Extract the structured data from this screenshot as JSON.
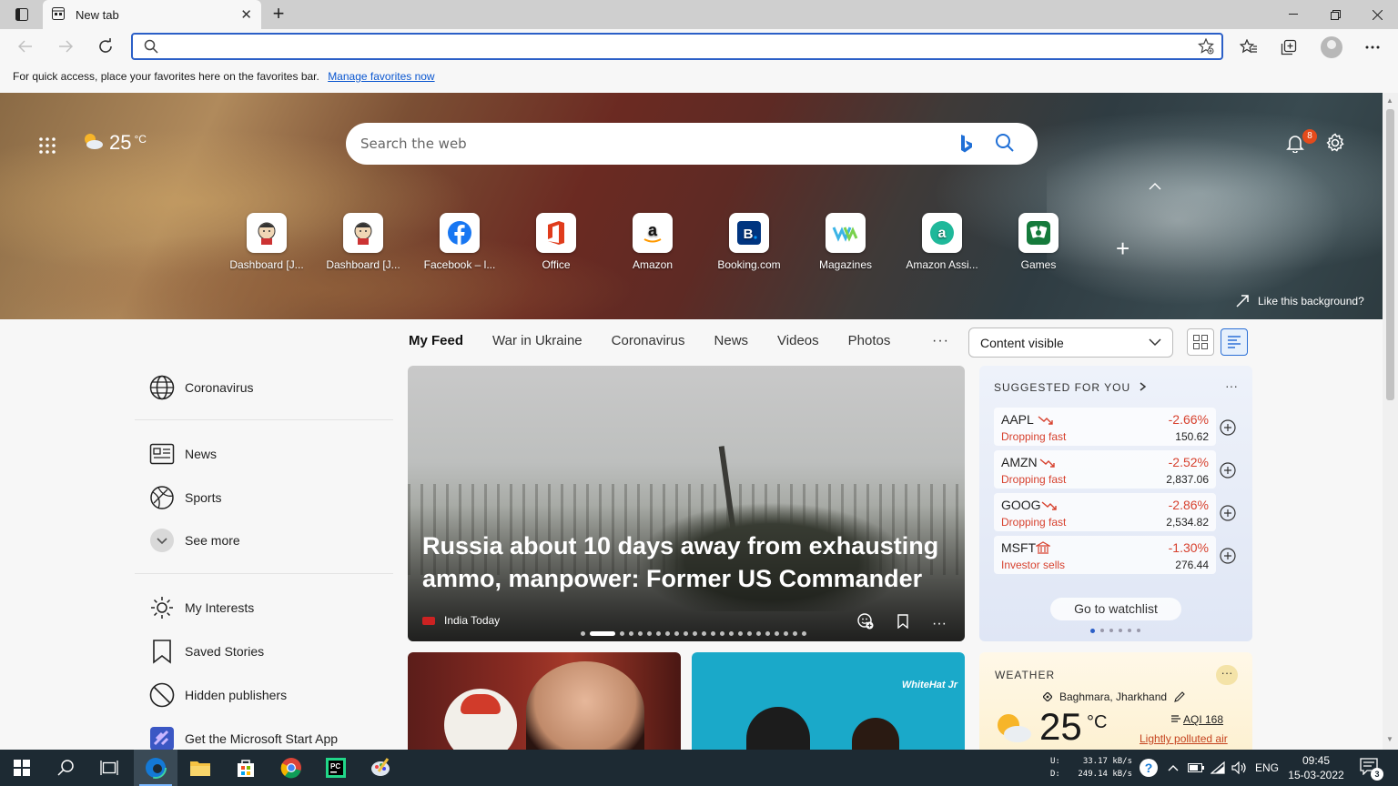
{
  "browser": {
    "tab_title": "New tab",
    "address_placeholder": "",
    "favorites_prompt": "For quick access, place your favorites here on the favorites bar.",
    "favorites_link": "Manage favorites now"
  },
  "hero": {
    "weather_temp": "25",
    "weather_unit": "°C",
    "search_placeholder": "Search the web",
    "notification_count": "8",
    "like_background": "Like this background?",
    "quick_links": [
      {
        "label": "Dashboard [J...",
        "icon": "jenkins-icon"
      },
      {
        "label": "Dashboard [J...",
        "icon": "jenkins-icon"
      },
      {
        "label": "Facebook – l...",
        "icon": "facebook-icon"
      },
      {
        "label": "Office",
        "icon": "office-icon"
      },
      {
        "label": "Amazon",
        "icon": "amazon-icon"
      },
      {
        "label": "Booking.com",
        "icon": "booking-icon"
      },
      {
        "label": "Magazines",
        "icon": "magazines-icon"
      },
      {
        "label": "Amazon Assi...",
        "icon": "amazon-assistant-icon"
      },
      {
        "label": "Games",
        "icon": "games-icon"
      }
    ]
  },
  "feed_nav": {
    "tabs": [
      "My Feed",
      "War in Ukraine",
      "Coronavirus",
      "News",
      "Videos",
      "Photos"
    ],
    "more": "···",
    "content_select": "Content visible"
  },
  "left_nav": {
    "coronavirus": "Coronavirus",
    "news": "News",
    "sports": "Sports",
    "see_more": "See more",
    "my_interests": "My Interests",
    "saved_stories": "Saved Stories",
    "hidden_publishers": "Hidden publishers",
    "ms_start": "Get the Microsoft Start App"
  },
  "main_article": {
    "headline": "Russia about 10 days away from exhausting ammo, manpower: Former US Commander",
    "source": "India Today",
    "more": "···"
  },
  "stocks": {
    "header": "SUGGESTED FOR YOU",
    "more": "···",
    "items": [
      {
        "symbol": "AAPL",
        "status": "Dropping fast",
        "change": "-2.66%",
        "price": "150.62"
      },
      {
        "symbol": "AMZN",
        "status": "Dropping fast",
        "change": "-2.52%",
        "price": "2,837.06"
      },
      {
        "symbol": "GOOG",
        "status": "Dropping fast",
        "change": "-2.86%",
        "price": "2,534.82"
      },
      {
        "symbol": "MSFT",
        "status": "Investor sells",
        "change": "-1.30%",
        "price": "276.44"
      }
    ],
    "watchlist_button": "Go to watchlist",
    "negative_color": "#d7422f"
  },
  "card3": {
    "brand": "WhiteHat Jr"
  },
  "weather_card": {
    "header": "WEATHER",
    "more": "···",
    "location": "Baghmara, Jharkhand",
    "temp": "25",
    "unit": "°C",
    "aqi": "AQI 168",
    "aqi_desc": "Lightly polluted air"
  },
  "taskbar": {
    "net_up_label": "U:",
    "net_up": "33.17 kB/s",
    "net_down_label": "D:",
    "net_down": "249.14 kB/s",
    "lang": "ENG",
    "time": "09:45",
    "date": "15-03-2022",
    "notification_count": "3"
  }
}
